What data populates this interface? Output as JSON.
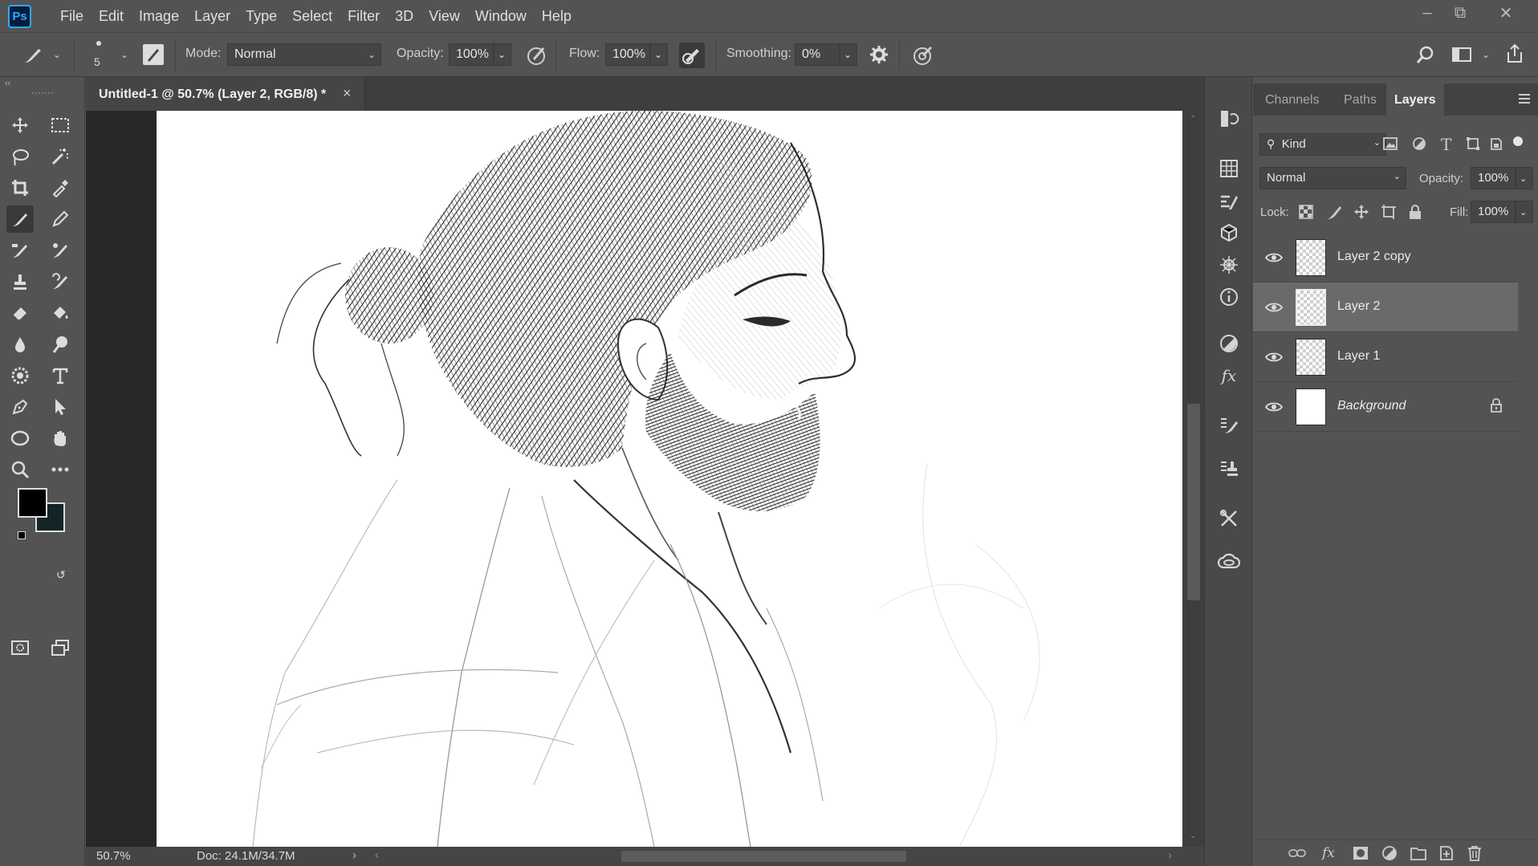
{
  "app": {
    "logo": "Ps",
    "menu": [
      "File",
      "Edit",
      "Image",
      "Layer",
      "Type",
      "Select",
      "Filter",
      "3D",
      "View",
      "Window",
      "Help"
    ]
  },
  "options": {
    "brush_size": "5",
    "mode_label": "Mode:",
    "mode_value": "Normal",
    "opacity_label": "Opacity:",
    "opacity_value": "100%",
    "flow_label": "Flow:",
    "flow_value": "100%",
    "smoothing_label": "Smoothing:",
    "smoothing_value": "0%"
  },
  "document": {
    "tab_title": "Untitled-1 @ 50.7% (Layer 2, RGB/8) *",
    "tab_close": "×",
    "zoom": "50.7%",
    "doc_size": "Doc: 24.1M/34.7M"
  },
  "layers_panel": {
    "tabs": [
      "Channels",
      "Paths",
      "Layers"
    ],
    "active_tab": "Layers",
    "filter_label": "Kind",
    "blend_mode": "Normal",
    "opacity_label": "Opacity:",
    "opacity_value": "100%",
    "lock_label": "Lock:",
    "fill_label": "Fill:",
    "fill_value": "100%",
    "layers": [
      {
        "name": "Layer 2 copy",
        "visible": true,
        "selected": false,
        "locked": false
      },
      {
        "name": "Layer 2",
        "visible": true,
        "selected": true,
        "locked": false
      },
      {
        "name": "Layer 1",
        "visible": true,
        "selected": false,
        "locked": false
      },
      {
        "name": "Background",
        "visible": true,
        "selected": false,
        "locked": true
      }
    ]
  },
  "colors": {
    "accent": "#31a8ff",
    "foreground": "#000000",
    "background_swatch": "#152426"
  }
}
